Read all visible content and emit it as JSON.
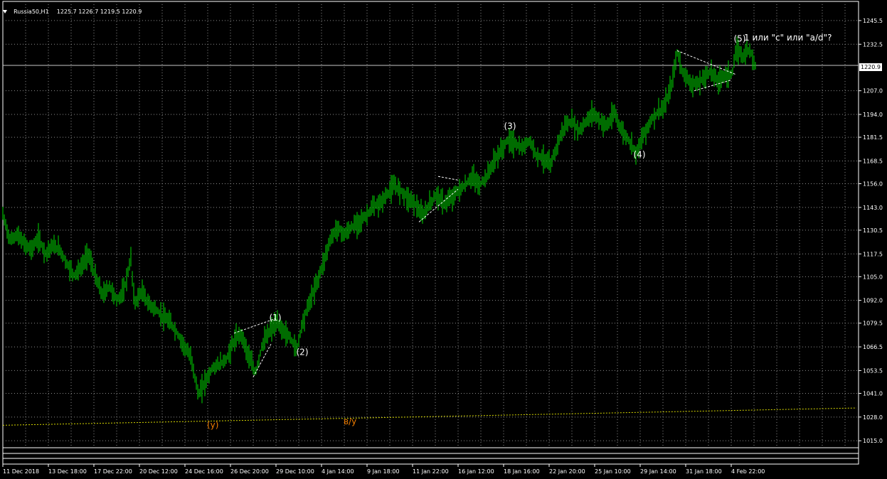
{
  "header": {
    "symbol": "Russia50,H1",
    "ohlc": "1225.7 1226.7 1219.5 1220.9"
  },
  "current_price": "1220.9",
  "annotations": {
    "question": "1 или \"с\" или \"a/d\"?",
    "y_label": "(y)",
    "dy_label": "в/у"
  },
  "colors": {
    "background": "#000000",
    "grid": "#8c8c8c",
    "candle": "#00b400",
    "wave_text": "#ffffff",
    "orange": "#f07d00",
    "yellow_line": "#d7d700",
    "price_line": "#c8c8c8"
  },
  "chart_data": {
    "type": "line",
    "title": "",
    "y_ticks": [
      "1245.5",
      "1232.5",
      "1220.9",
      "1207.0",
      "1194.0",
      "1181.5",
      "1168.5",
      "1156.0",
      "1143.0",
      "1130.5",
      "1117.5",
      "1105.0",
      "1092.0",
      "1079.5",
      "1066.5",
      "1053.5",
      "1041.0",
      "1028.0",
      "1015.0"
    ],
    "y_tick_values": [
      1245.5,
      1232.5,
      1220.9,
      1207.0,
      1194.0,
      1181.5,
      1168.5,
      1156.0,
      1143.0,
      1130.5,
      1117.5,
      1105.0,
      1092.0,
      1079.5,
      1066.5,
      1053.5,
      1041.0,
      1028.0,
      1015.0
    ],
    "x_ticks": [
      "11 Dec 2018",
      "13 Dec 18:00",
      "17 Dec 22:00",
      "20 Dec 12:00",
      "24 Dec 16:00",
      "26 Dec 20:00",
      "29 Dec 10:00",
      "4 Jan 14:00",
      "9 Jan 18:00",
      "11 Jan 22:00",
      "16 Jan 12:00",
      "18 Jan 16:00",
      "22 Jan 20:00",
      "25 Jan 10:00",
      "29 Jan 14:00",
      "31 Jan 18:00",
      "4 Feb 22:00"
    ],
    "ylim": [
      1010.0,
      1256.0
    ],
    "grid": true,
    "price_path": [
      [
        0,
        1139
      ],
      [
        10,
        1125
      ],
      [
        20,
        1128
      ],
      [
        30,
        1123
      ],
      [
        40,
        1120
      ],
      [
        50,
        1126
      ],
      [
        60,
        1118
      ],
      [
        70,
        1122
      ],
      [
        80,
        1120
      ],
      [
        90,
        1112
      ],
      [
        100,
        1106
      ],
      [
        110,
        1110
      ],
      [
        120,
        1118
      ],
      [
        130,
        1105
      ],
      [
        140,
        1095
      ],
      [
        150,
        1100
      ],
      [
        160,
        1092
      ],
      [
        170,
        1097
      ],
      [
        180,
        1115
      ],
      [
        185,
        1090
      ],
      [
        195,
        1097
      ],
      [
        205,
        1090
      ],
      [
        215,
        1087
      ],
      [
        225,
        1083
      ],
      [
        235,
        1080
      ],
      [
        245,
        1074
      ],
      [
        255,
        1067
      ],
      [
        265,
        1060
      ],
      [
        275,
        1040
      ],
      [
        285,
        1048
      ],
      [
        295,
        1055
      ],
      [
        305,
        1057
      ],
      [
        315,
        1060
      ],
      [
        325,
        1070
      ],
      [
        335,
        1074
      ],
      [
        345,
        1062
      ],
      [
        355,
        1052
      ],
      [
        365,
        1068
      ],
      [
        375,
        1075
      ],
      [
        385,
        1080
      ],
      [
        395,
        1075
      ],
      [
        405,
        1071
      ],
      [
        413,
        1065
      ],
      [
        420,
        1078
      ],
      [
        430,
        1090
      ],
      [
        440,
        1100
      ],
      [
        450,
        1112
      ],
      [
        460,
        1125
      ],
      [
        470,
        1132
      ],
      [
        480,
        1128
      ],
      [
        490,
        1132
      ],
      [
        500,
        1135
      ],
      [
        510,
        1138
      ],
      [
        520,
        1143
      ],
      [
        530,
        1145
      ],
      [
        540,
        1150
      ],
      [
        550,
        1155
      ],
      [
        560,
        1152
      ],
      [
        570,
        1148
      ],
      [
        580,
        1145
      ],
      [
        590,
        1138
      ],
      [
        600,
        1145
      ],
      [
        610,
        1150
      ],
      [
        620,
        1145
      ],
      [
        630,
        1148
      ],
      [
        640,
        1152
      ],
      [
        650,
        1155
      ],
      [
        660,
        1160
      ],
      [
        670,
        1155
      ],
      [
        680,
        1160
      ],
      [
        690,
        1168
      ],
      [
        700,
        1174
      ],
      [
        710,
        1180
      ],
      [
        720,
        1178
      ],
      [
        730,
        1175
      ],
      [
        740,
        1180
      ],
      [
        750,
        1172
      ],
      [
        760,
        1170
      ],
      [
        770,
        1166
      ],
      [
        780,
        1178
      ],
      [
        790,
        1188
      ],
      [
        800,
        1190
      ],
      [
        810,
        1185
      ],
      [
        820,
        1190
      ],
      [
        830,
        1195
      ],
      [
        840,
        1190
      ],
      [
        850,
        1188
      ],
      [
        860,
        1195
      ],
      [
        870,
        1185
      ],
      [
        880,
        1180
      ],
      [
        890,
        1173
      ],
      [
        900,
        1182
      ],
      [
        910,
        1190
      ],
      [
        920,
        1195
      ],
      [
        930,
        1198
      ],
      [
        940,
        1210
      ],
      [
        948,
        1228
      ],
      [
        955,
        1218
      ],
      [
        965,
        1212
      ],
      [
        975,
        1210
      ],
      [
        985,
        1214
      ],
      [
        995,
        1218
      ],
      [
        1005,
        1212
      ],
      [
        1015,
        1216
      ],
      [
        1025,
        1216
      ],
      [
        1032,
        1230
      ],
      [
        1040,
        1226
      ],
      [
        1050,
        1230
      ],
      [
        1058,
        1221
      ]
    ],
    "wave_labels": [
      {
        "text": "(1)",
        "x_index": 383,
        "price": 1081.0
      },
      {
        "text": "(2)",
        "x_index": 421,
        "price": 1062.0
      },
      {
        "text": "(3)",
        "x_index": 713,
        "price": 1186.0
      },
      {
        "text": "(4)",
        "x_index": 895,
        "price": 1170.5
      },
      {
        "text": "(5)",
        "x_index": 1036,
        "price": 1234.0
      }
    ]
  }
}
